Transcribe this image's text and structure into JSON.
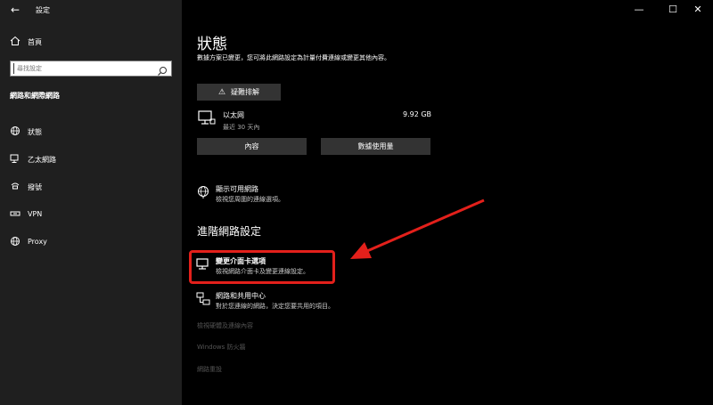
{
  "window": {
    "title": "設定",
    "back_glyph": "←",
    "minimize_glyph": "—",
    "maximize_glyph": "☐",
    "close_glyph": "✕"
  },
  "sidebar": {
    "home_label": "首頁",
    "search_placeholder": "尋找設定",
    "section_title": "網路和網際網路",
    "items": [
      {
        "label": "狀態",
        "icon": "globe-icon"
      },
      {
        "label": "乙太網路",
        "icon": "ethernet-icon"
      },
      {
        "label": "撥號",
        "icon": "dialup-icon"
      },
      {
        "label": "VPN",
        "icon": "vpn-icon"
      },
      {
        "label": "Proxy",
        "icon": "globe-icon"
      }
    ]
  },
  "main": {
    "title": "狀態",
    "description": "數據方案已變更，您可將此網路設定為計量付費連線或變更其他內容。",
    "troubleshoot_label": "疑難排解",
    "connection": {
      "name": "以太网",
      "subtitle": "最近 30 天內",
      "usage": "9.92 GB"
    },
    "properties_label": "內容",
    "data_usage_label": "數據使用量",
    "show_networks": {
      "title": "顯示可用網路",
      "subtitle": "檢視您周圍的連線選項。"
    },
    "advanced_heading": "進階網路設定",
    "change_adapter": {
      "title": "變更介面卡選項",
      "subtitle": "檢視網路介面卡及變更連線設定。"
    },
    "sharing_center": {
      "title": "網路和共用中心",
      "subtitle": "對於您連線的網路，決定您要共用的項目。"
    },
    "dim_links": [
      "檢視硬體及連線內容",
      "Windows 防火牆",
      "網路重設"
    ]
  },
  "colors": {
    "sidebar_bg": "#1f1f1f",
    "main_bg": "#000000",
    "button_bg": "#333333",
    "highlight": "#e3201b"
  }
}
